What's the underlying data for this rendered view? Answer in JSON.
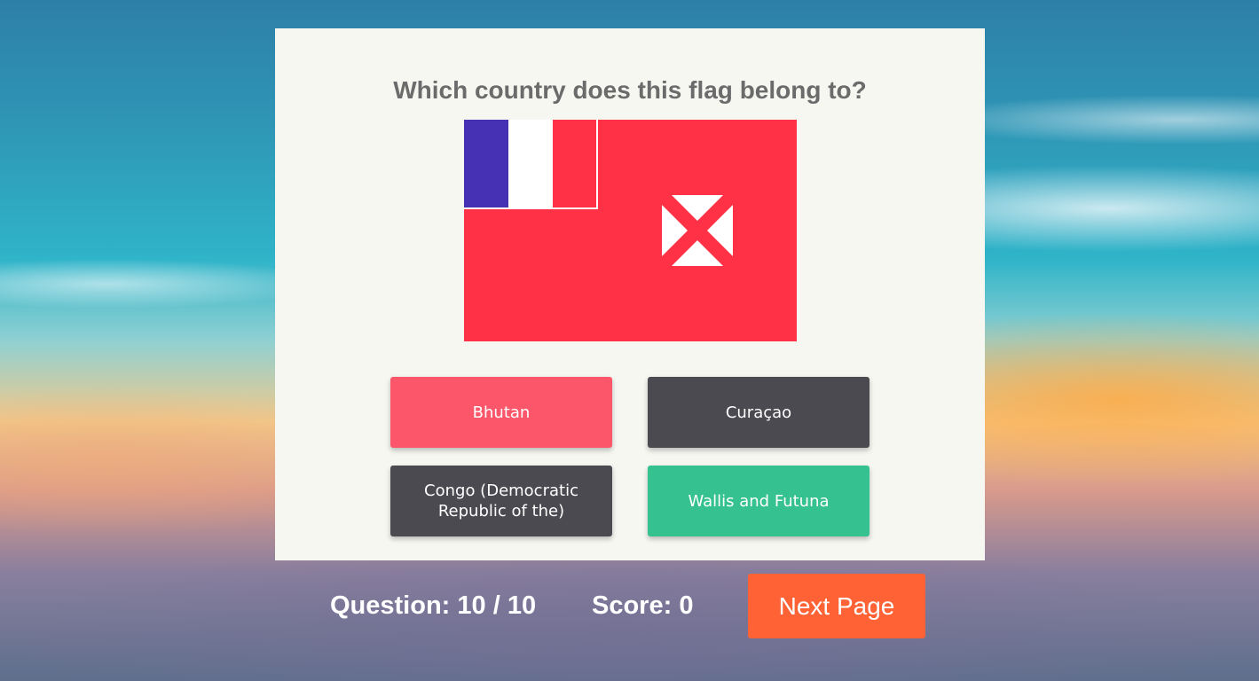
{
  "quiz": {
    "question": "Which country does this flag belong to?",
    "flag": {
      "country": "Wallis and Futuna",
      "colors": {
        "blue": "#4631b5",
        "white": "#ffffff",
        "red": "#ff3146"
      }
    },
    "answers": [
      {
        "label": "Bhutan",
        "state": "wrong"
      },
      {
        "label": "Curaçao",
        "state": "neutral"
      },
      {
        "label": "Congo (Democratic Republic of the)",
        "state": "neutral"
      },
      {
        "label": "Wallis and Futuna",
        "state": "correct"
      }
    ]
  },
  "footer": {
    "question_progress": "Question: 10 / 10",
    "score": "Score: 0",
    "next_label": "Next Page"
  },
  "colors": {
    "wrong": "#fc566a",
    "neutral": "#4a4a50",
    "correct": "#35c190",
    "next_button": "#ff6335"
  }
}
